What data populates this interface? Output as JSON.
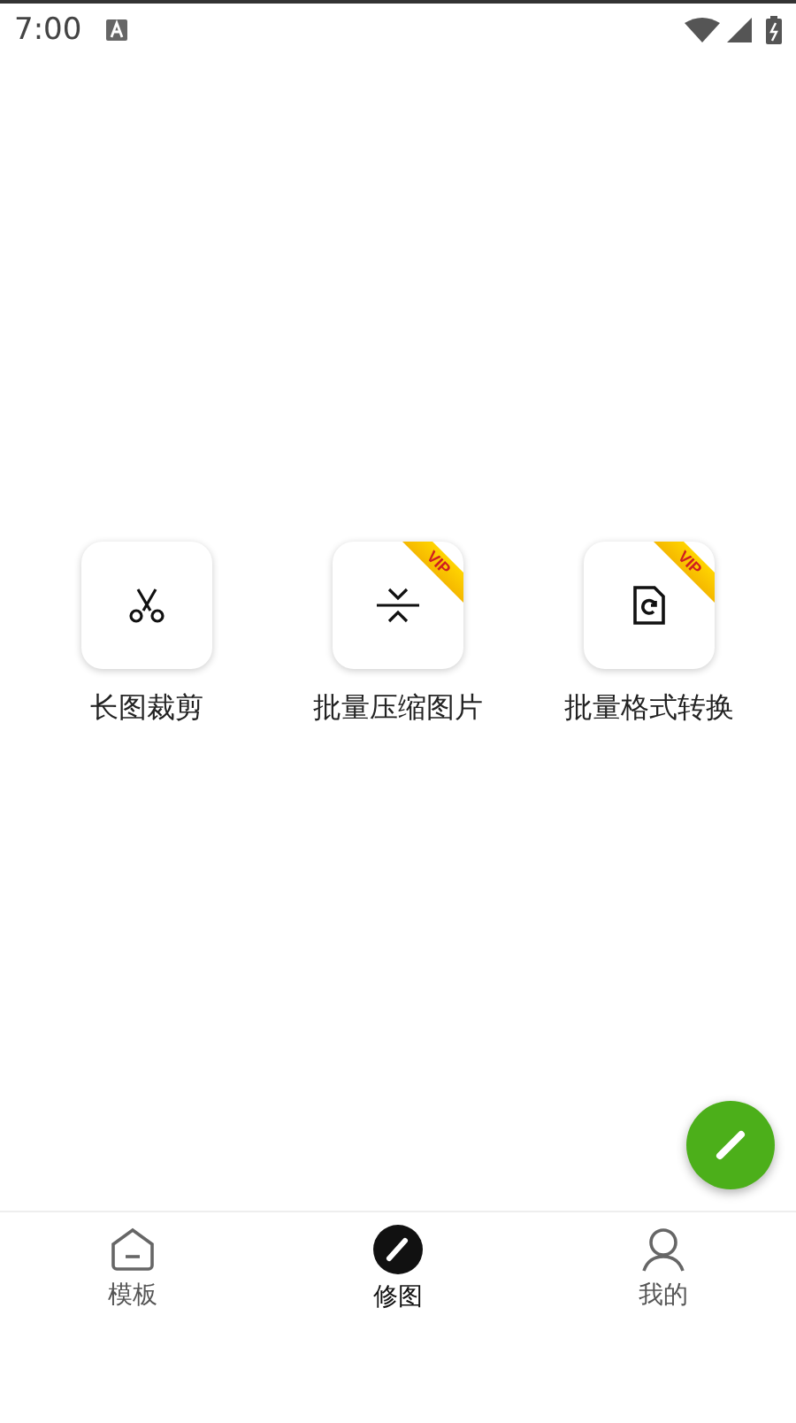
{
  "status_bar": {
    "time": "7:00"
  },
  "tools": [
    {
      "kind": "crop",
      "label": "长图裁剪"
    },
    {
      "kind": "compress",
      "label": "批量压缩图片",
      "badge": "VIP"
    },
    {
      "kind": "convert",
      "label": "批量格式转换",
      "badge": "VIP"
    }
  ],
  "bottom_nav": [
    {
      "kind": "template",
      "label": "模板",
      "selected": false
    },
    {
      "kind": "edit",
      "label": "修图",
      "selected": true
    },
    {
      "kind": "profile",
      "label": "我的",
      "selected": false
    }
  ]
}
